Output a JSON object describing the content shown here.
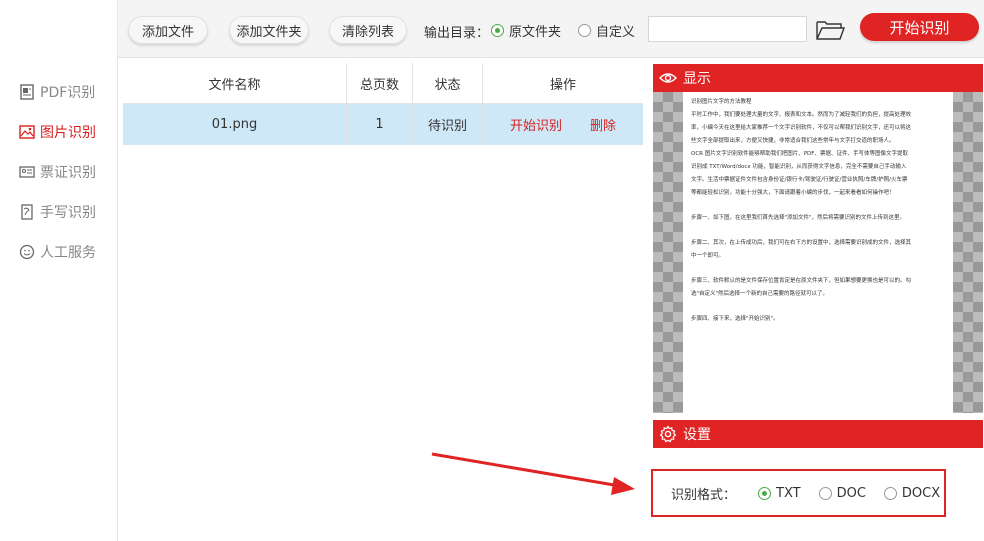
{
  "sidebar": {
    "items": [
      {
        "label": "PDF识别",
        "icon": "pdf-icon"
      },
      {
        "label": "图片识别",
        "icon": "image-icon"
      },
      {
        "label": "票证识别",
        "icon": "id-card-icon"
      },
      {
        "label": "手写识别",
        "icon": "handwriting-icon"
      },
      {
        "label": "人工服务",
        "icon": "smiley-icon"
      }
    ]
  },
  "toolbar": {
    "add_file": "添加文件",
    "add_folder": "添加文件夹",
    "clear_list": "清除列表",
    "output_label": "输出目录：",
    "option_source": "原文件夹",
    "option_custom": "自定义",
    "start": "开始识别"
  },
  "table": {
    "headers": [
      "文件名称",
      "总页数",
      "状态",
      "操作"
    ],
    "rows": [
      {
        "name": "01.png",
        "pages": "1",
        "status": "待识别",
        "action_start": "开始识别",
        "action_delete": "删除"
      }
    ]
  },
  "preview": {
    "title": "显示",
    "lines": [
      "识别图片文字的方法教程",
      "平时工作中，我们要处理大量的文字、报表和文本。然而为了减轻我们的负担，提高处理效",
      "率，小编今天在这里给大家推荐一个文字识别软件，不仅可以帮我们识别文字，还可以将这",
      "些文字全部提取出来，方便又快捷，非常适合我们这些常年与文字打交道的职场人。",
      "OCR 图片文字识别软件能够帮助我们把图片、PDF、票据、证件、手写体等图像文字提取",
      "识别成 TXT/Word/docx 功能，智能识别，从而获得文字信息，完全不需要自己手动输入",
      "文字。生活中票据证件文件包含身份证/银行卡/驾驶证/行驶证/营业执照/车牌/护照/火车票",
      "等都能轻松识别，功能十分强大，下面请跟着小编的步伐，一起来看看如何操作吧！",
      "步骤一、如下图，在这里我们首先选择\"添加文件\"，然后将需要识别的文件上传到这里。",
      "步骤二、其次，在上传成功后，我们可在右下方的设置中，选择需要识别成的文件，选择其",
      "中一个即可。",
      "步骤三、软件默认的是文件保存位置肯定是在原文件夹下，但如果想要更换也是可以的。勾",
      "选\"自定义\"然后选择一个新的自己需要的路径就可以了。",
      "步骤四、接下来，选择\"开始识别\"。"
    ]
  },
  "settings": {
    "title": "设置",
    "format_label": "识别格式：",
    "formats": [
      "TXT",
      "DOC",
      "DOCX"
    ]
  },
  "colors": {
    "accent": "#e02424",
    "selected_row": "#cfe8f7",
    "radio_on": "#4aa84a"
  }
}
